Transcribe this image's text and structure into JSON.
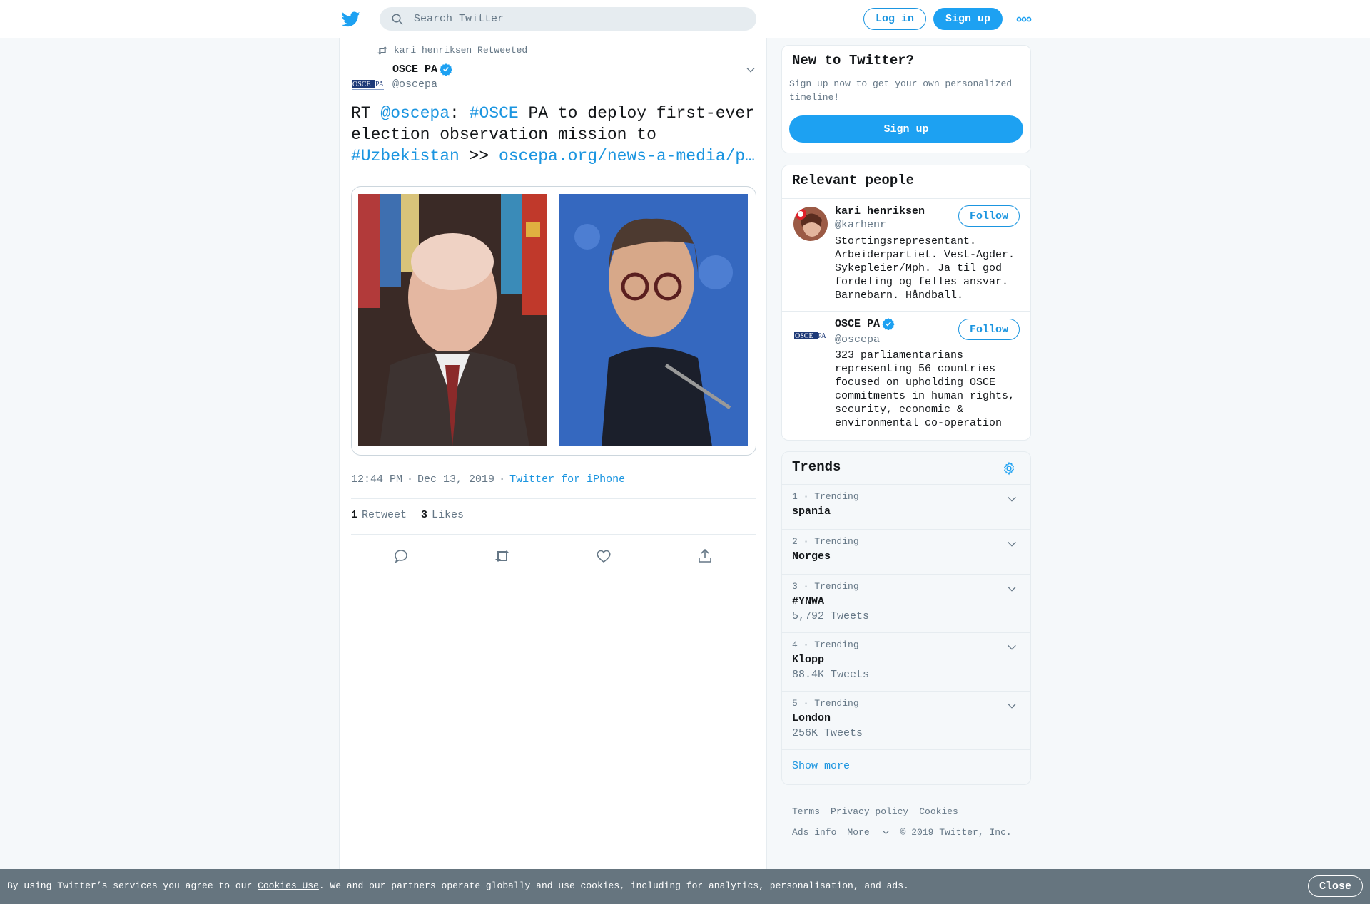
{
  "header": {
    "search_placeholder": "Search Twitter",
    "login_label": "Log in",
    "signup_label": "Sign up"
  },
  "tweet": {
    "retweeted_by": "kari henriksen Retweeted",
    "author_name": "OSCE PA",
    "author_handle": "@oscepa",
    "text": {
      "rt": "RT ",
      "mention": "@oscepa",
      "colon": ": ",
      "hashtag1": "#OSCE",
      "line1_rest": " PA to deploy first-ever",
      "line2": "election observation mission to",
      "hashtag2": "#Uzbekistan",
      "arrows": " >> ",
      "link": "oscepa.org/news-a-media/p…"
    },
    "time": "12:44 PM",
    "date": "Dec 13, 2019",
    "source": "Twitter for iPhone",
    "retweets_count": "1",
    "retweets_label": "Retweet",
    "likes_count": "3",
    "likes_label": "Likes"
  },
  "sidebar": {
    "new_to_twitter": {
      "title": "New to Twitter?",
      "desc": "Sign up now to get your own personalized timeline!",
      "button": "Sign up"
    },
    "relevant_people": {
      "title": "Relevant people",
      "people": [
        {
          "name": "kari henriksen",
          "handle": "@karhenr",
          "bio": "Stortingsrepresentant. Arbeiderpartiet. Vest-Agder. Sykepleier/Mph. Ja til god fordeling og felles ansvar. Barnebarn. Håndball.",
          "follow": "Follow"
        },
        {
          "name": "OSCE PA",
          "handle": "@oscepa",
          "bio": "323 parliamentarians representing 56 countries focused on upholding OSCE commitments in human rights, security, economic & environmental co-operation",
          "follow": "Follow"
        }
      ]
    },
    "trends": {
      "title": "Trends",
      "items": [
        {
          "rank": "1 · Trending",
          "topic": "spania",
          "count": ""
        },
        {
          "rank": "2 · Trending",
          "topic": "Norges",
          "count": ""
        },
        {
          "rank": "3 · Trending",
          "topic": "#YNWA",
          "count": "5,792 Tweets"
        },
        {
          "rank": "4 · Trending",
          "topic": "Klopp",
          "count": "88.4K Tweets"
        },
        {
          "rank": "5 · Trending",
          "topic": "London",
          "count": "256K Tweets"
        }
      ],
      "show_more": "Show more"
    },
    "footer": {
      "terms": "Terms",
      "privacy": "Privacy policy",
      "cookies": "Cookies",
      "ads_info": "Ads info",
      "more": "More",
      "copyright": "© 2019 Twitter, Inc."
    }
  },
  "cookie_bar": {
    "prefix": "By using Twitter’s services you agree to our ",
    "link": "Cookies Use",
    "suffix": ". We and our partners operate globally and use cookies, including for analytics, personalisation, and ads.",
    "close": "Close"
  },
  "colors": {
    "accent": "#1da1f2",
    "link": "#1b95e0",
    "verified": "#1da1f2"
  },
  "icons": [
    "twitter-logo-icon",
    "search-icon",
    "more-dots-icon",
    "retweet-icon",
    "verified-badge-icon",
    "chevron-down-icon",
    "reply-icon",
    "like-icon",
    "share-icon",
    "gear-icon"
  ]
}
